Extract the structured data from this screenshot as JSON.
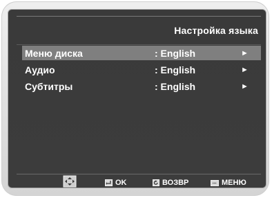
{
  "header": {
    "title": "Настройка языка"
  },
  "menu": {
    "items": [
      {
        "label": "Меню диска",
        "value": ": English",
        "arrow": "►",
        "selected": true
      },
      {
        "label": "Аудио",
        "value": ": English",
        "arrow": "►",
        "selected": false
      },
      {
        "label": "Субтитры",
        "value": ": English",
        "arrow": "►",
        "selected": false
      }
    ]
  },
  "footer": {
    "ok_label": "OK",
    "back_label": "ВОЗВР",
    "menu_label": "МЕНЮ"
  },
  "colors": {
    "screen_bg": "#3a3a3a",
    "selected_bg": "#7f7f7f",
    "text": "#ffffff"
  }
}
